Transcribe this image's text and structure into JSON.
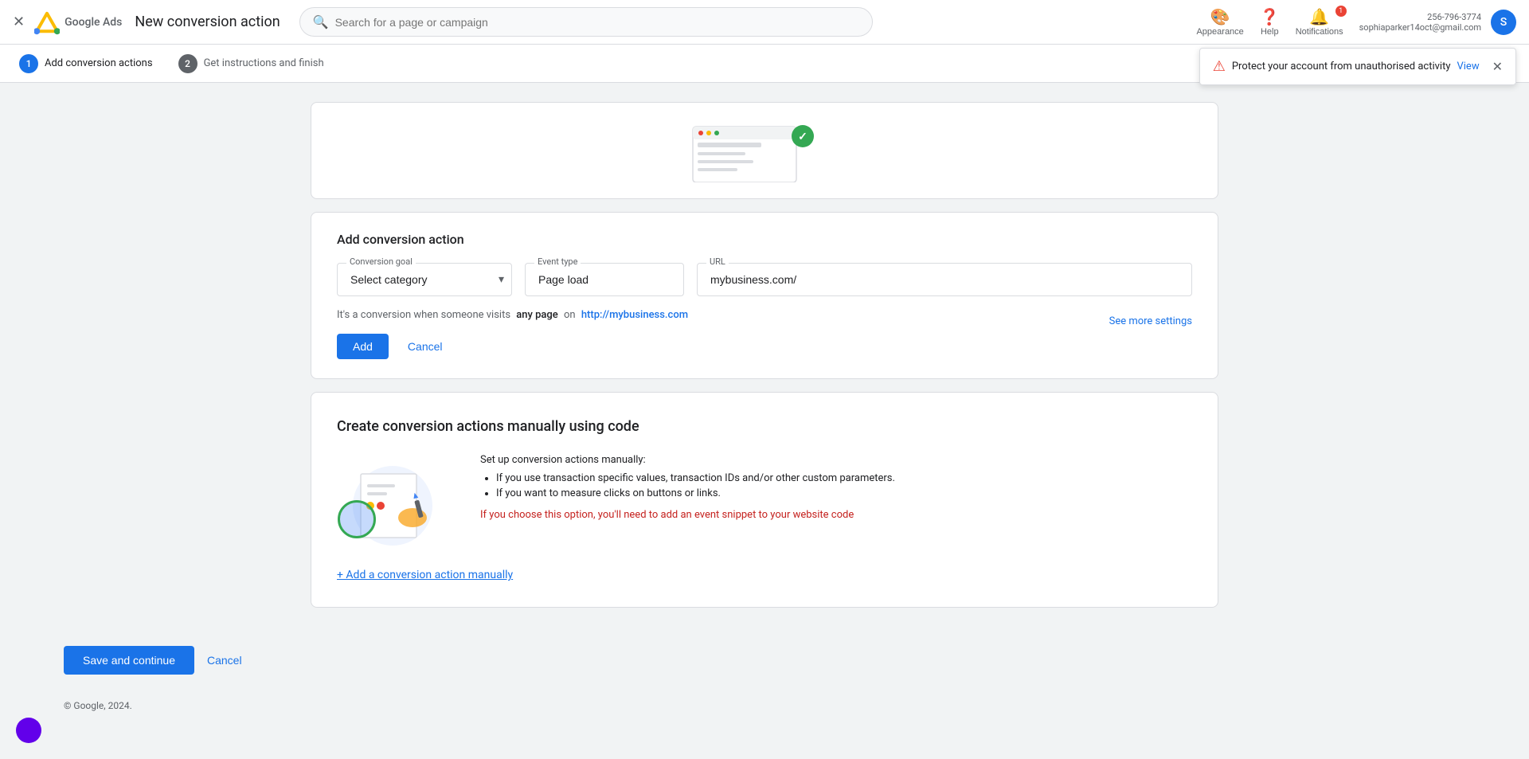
{
  "nav": {
    "close_icon": "✕",
    "page_title": "New conversion action",
    "search_placeholder": "Search for a page or campaign",
    "appearance_label": "Appearance",
    "help_label": "Help",
    "notifications_label": "Notifications",
    "notifications_count": "1",
    "user_email": "256-796-3774\nsophiaparker14oct@gmail.com",
    "user_initials": "S"
  },
  "stepper": {
    "step1_num": "1",
    "step1_label": "Add conversion actions",
    "step2_num": "2",
    "step2_label": "Get instructions and finish"
  },
  "notification_banner": {
    "text": "Protect your account from unauthorised activity",
    "view_label": "View",
    "dismiss_icon": "✕"
  },
  "conversion_form": {
    "card_title": "Add conversion action",
    "conversion_goal_label": "Conversion goal",
    "conversion_goal_placeholder": "Select category",
    "event_type_label": "Event type",
    "event_type_value": "Page load",
    "url_label": "URL",
    "url_value": "mybusiness.com/",
    "hint_text_prefix": "It's a conversion when someone visits",
    "hint_bold": "any page",
    "hint_on": "on",
    "hint_url": "http://mybusiness.com",
    "see_more_label": "See more settings",
    "add_btn": "Add",
    "cancel_btn": "Cancel"
  },
  "manual_section": {
    "card_title": "Create conversion actions manually using code",
    "info_intro": "Set up conversion actions manually:",
    "bullet1": "If you use transaction specific values, transaction IDs and/or other custom parameters.",
    "bullet2": "If you want to measure clicks on buttons or links.",
    "note": "If you choose this option, you'll need to add an event snippet to your website code",
    "add_manual_label": "+ Add a conversion action manually"
  },
  "bottom_actions": {
    "save_label": "Save and continue",
    "cancel_label": "Cancel"
  },
  "footer": {
    "text": "© Google, 2024."
  }
}
